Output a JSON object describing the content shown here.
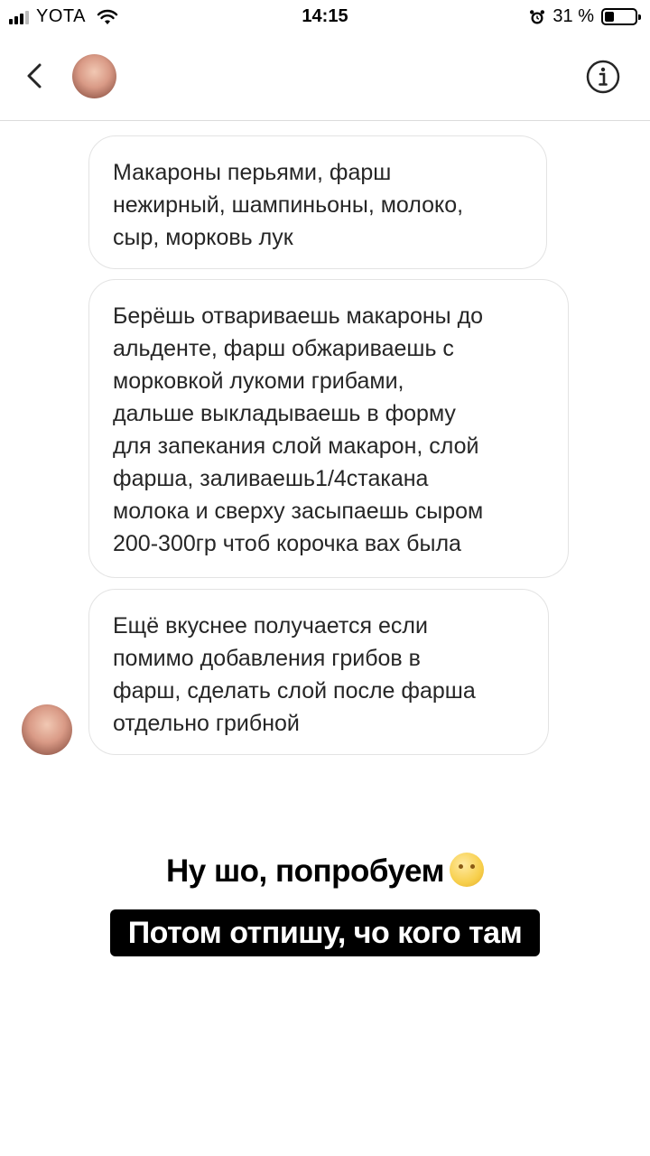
{
  "status_bar": {
    "carrier": "YOTA",
    "time": "14:15",
    "battery_percent": "31 %",
    "battery_level": 0.31,
    "icons": [
      "signal-icon",
      "wifi-icon",
      "alarm-icon",
      "battery-icon"
    ]
  },
  "header": {
    "icons": [
      "back-icon",
      "avatar",
      "info-icon"
    ]
  },
  "messages": [
    {
      "text": "Макароны перьями, фарш\nнежирный, шампиньоны, молоко,\nсыр, морковь лук"
    },
    {
      "text": "Берёшь отвариваешь макароны до\nальденте, фарш обжариваешь с\nморковкой лукоми грибами,\nдальше выкладываешь в форму\nдля запекания слой макарон, слой\nфарша, заливаешь1/4стакана\nмолока и сверху засыпаешь сыром\n200-300гр чтоб корочка вах была"
    },
    {
      "text": "Ещё вкуснее получается если\nпомимо добавления грибов в\nфарш, сделать слой после фарша\nотдельно грибной"
    }
  ],
  "captions": {
    "line1": "Ну шо, попробуем",
    "line2": "Потом отпишу, чо кого там"
  }
}
